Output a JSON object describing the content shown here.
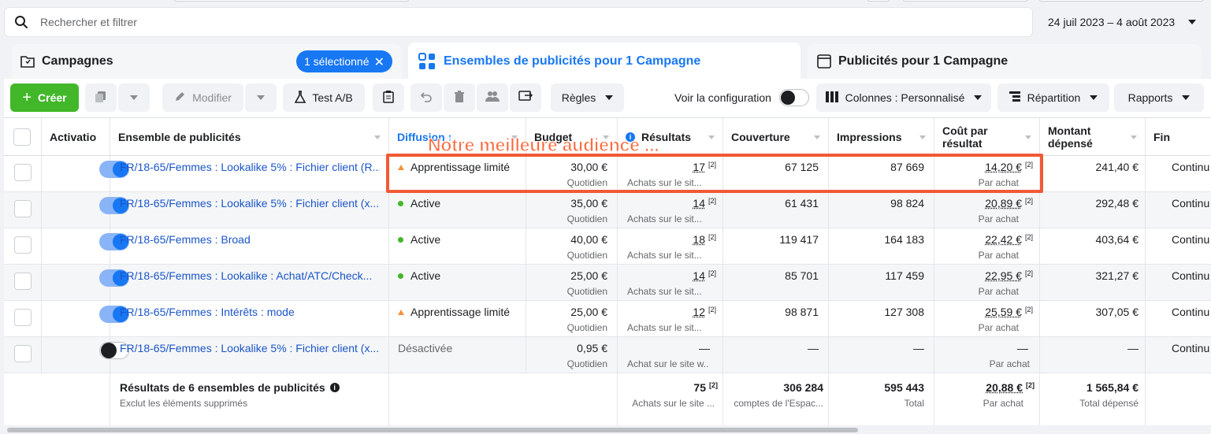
{
  "search": {
    "placeholder": "Rechercher et filtrer"
  },
  "date_range": "24 juil 2023 – 4 août 2023",
  "tabs": {
    "campaigns": "Campagnes",
    "selected_badge": "1 sélectionné",
    "adsets": "Ensembles de publicités pour 1 Campagne",
    "ads": "Publicités pour 1 Campagne"
  },
  "toolbar": {
    "create": "Créer",
    "edit": "Modifier",
    "ab_test": "Test A/B",
    "rules": "Règles",
    "view_config": "Voir la configuration",
    "columns": "Colonnes : Personnalisé",
    "breakdown": "Répartition",
    "reports": "Rapports"
  },
  "columns": {
    "activation": "Activatio",
    "adset": "Ensemble de publicités",
    "delivery": "Diffusion",
    "budget": "Budget",
    "results": "Résultats",
    "reach": "Couverture",
    "impressions": "Impressions",
    "cpr_line1": "Coût par",
    "cpr_line2": "résultat",
    "spent_line1": "Montant",
    "spent_line2": "dépensé",
    "end": "Fin"
  },
  "rows": [
    {
      "name": "FR/18-65/Femmes : Lookalike 5% : Fichier client (R...",
      "delivery": "Apprentissage limité",
      "budget": "30,00 €",
      "budget_sub": "Quotidien",
      "results": "17",
      "results_sub": "Achats sur le sit...",
      "reach": "67 125",
      "impressions": "87 669",
      "cpr": "14,20 €",
      "cpr_sub": "Par achat",
      "spent": "241,40 €",
      "end": "Continu"
    },
    {
      "name": "FR/18-65/Femmes : Lookalike 5% : Fichier client (x...",
      "delivery": "Active",
      "budget": "35,00 €",
      "budget_sub": "Quotidien",
      "results": "14",
      "results_sub": "Achats sur le sit...",
      "reach": "61 431",
      "impressions": "98 824",
      "cpr": "20,89 €",
      "cpr_sub": "Par achat",
      "spent": "292,48 €",
      "end": "Continu"
    },
    {
      "name": "FR/18-65/Femmes : Broad",
      "delivery": "Active",
      "budget": "40,00 €",
      "budget_sub": "Quotidien",
      "results": "18",
      "results_sub": "Achats sur le sit...",
      "reach": "119 417",
      "impressions": "164 183",
      "cpr": "22,42 €",
      "cpr_sub": "Par achat",
      "spent": "403,64 €",
      "end": "Continu"
    },
    {
      "name": "FR/18-65/Femmes : Lookalike : Achat/ATC/Check...",
      "delivery": "Active",
      "budget": "25,00 €",
      "budget_sub": "Quotidien",
      "results": "14",
      "results_sub": "Achats sur le sit...",
      "reach": "85 701",
      "impressions": "117 459",
      "cpr": "22,95 €",
      "cpr_sub": "Par achat",
      "spent": "321,27 €",
      "end": "Continu"
    },
    {
      "name": "FR/18-65/Femmes : Intérêts : mode",
      "delivery": "Apprentissage limité",
      "budget": "25,00 €",
      "budget_sub": "Quotidien",
      "results": "12",
      "results_sub": "Achats sur le sit...",
      "reach": "98 871",
      "impressions": "127 308",
      "cpr": "25,59 €",
      "cpr_sub": "Par achat",
      "spent": "307,05 €",
      "end": "Continu"
    },
    {
      "name": "FR/18-65/Femmes : Lookalike 5% : Fichier client (x...",
      "delivery": "Désactivée",
      "budget": "0,95 €",
      "budget_sub": "Quotidien",
      "results": "—",
      "results_sub": "Achat sur le site w...",
      "reach": "—",
      "impressions": "—",
      "cpr": "—",
      "cpr_sub": "Par achat",
      "spent": "—",
      "end": "Continu"
    }
  ],
  "totals": {
    "label": "Résultats de 6 ensembles de publicités",
    "sublabel": "Exclut les éléments supprimés",
    "results": "75",
    "results_sub": "Achats sur le site ...",
    "reach": "306 284",
    "reach_sub": "comptes de l'Espac...",
    "impressions": "595 443",
    "impressions_sub": "Total",
    "cpr": "20,88 €",
    "cpr_sub": "Par achat",
    "spent": "1 565,84 €",
    "spent_sub": "Total dépensé"
  },
  "annotation": "Notre meilleure audience ...",
  "footnote_marker": "[2]"
}
